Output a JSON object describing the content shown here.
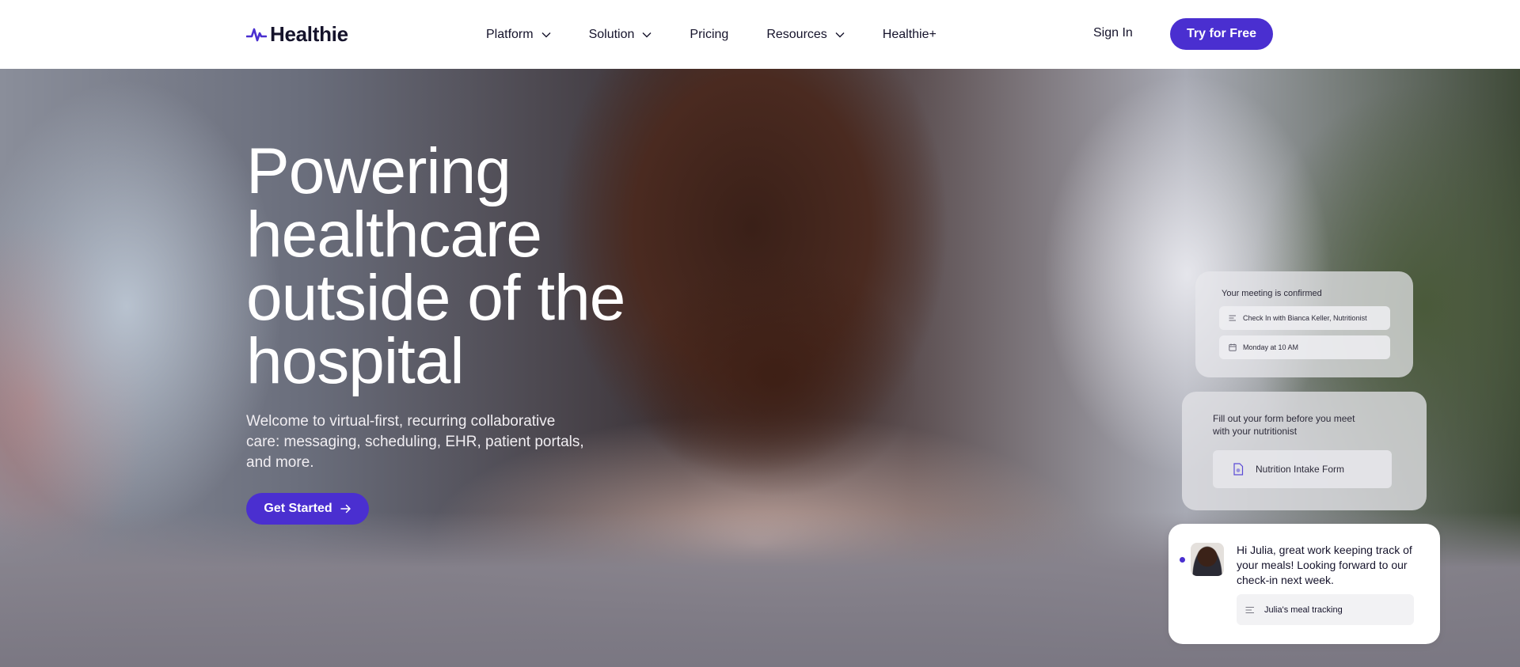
{
  "brand": {
    "name": "Healthie",
    "accent": "#4a2fd0"
  },
  "nav": {
    "items": [
      {
        "label": "Platform",
        "dropdown": true
      },
      {
        "label": "Solution",
        "dropdown": true
      },
      {
        "label": "Pricing",
        "dropdown": false
      },
      {
        "label": "Resources",
        "dropdown": true
      },
      {
        "label": "Healthie+",
        "dropdown": false
      }
    ],
    "sign_in": "Sign In",
    "try_free": "Try for Free"
  },
  "hero": {
    "title_lines": [
      "Powering",
      "healthcare",
      "outside of the",
      "hospital"
    ],
    "subtitle": "Welcome to virtual-first, recurring collaborative care: messaging, scheduling, EHR, patient portals, and more.",
    "cta": "Get Started"
  },
  "cards": {
    "meeting": {
      "title": "Your meeting is confirmed",
      "items": [
        "Check In with Bianca Keller, Nutritionist",
        "Monday at 10 AM"
      ]
    },
    "form": {
      "title": "Fill out your form before you meet with your nutritionist",
      "item": "Nutrition Intake Form"
    },
    "message": {
      "text": "Hi Julia, great work keeping track of your meals! Looking forward to our check-in next week.",
      "attachment": "Julia's meal tracking"
    }
  }
}
